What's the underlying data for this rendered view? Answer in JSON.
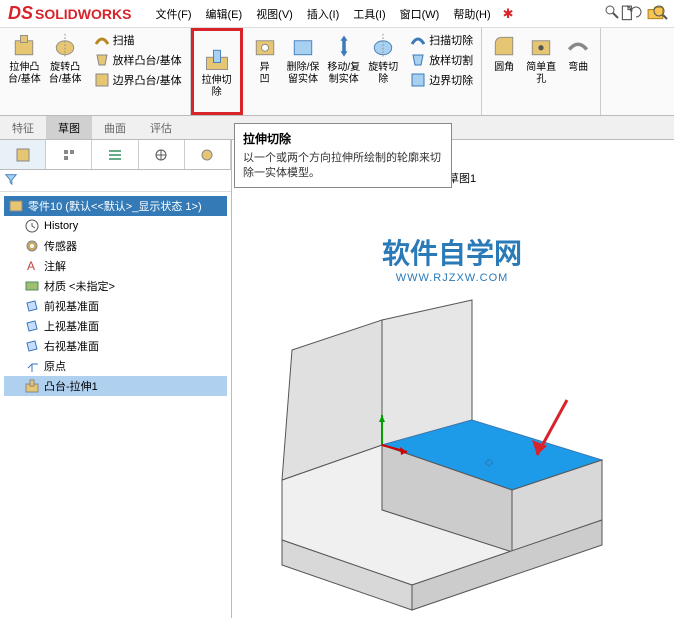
{
  "app": {
    "name": "SOLIDWORKS",
    "logo_prefix": "DS"
  },
  "menu": {
    "file": "文件(F)",
    "edit": "编辑(E)",
    "view": "视图(V)",
    "insert": "插入(I)",
    "tools": "工具(I)",
    "window": "窗口(W)",
    "help": "帮助(H)"
  },
  "ribbon": {
    "extrude_boss": "拉伸凸\n台/基体",
    "revolve_boss": "旋转凸\n台/基体",
    "sweep": "扫描",
    "loft": "放样凸台/基体",
    "boundary": "边界凸台/基体",
    "extrude_cut": "拉伸切\n除",
    "wizard": "异\n凹",
    "delete_keep": "删除/保\n留实体",
    "move_copy": "移动/复\n制实体",
    "revolve_cut": "旋转切\n除",
    "sweep_cut": "扫描切除",
    "loft_cut": "放样切割",
    "boundary_cut": "边界切除",
    "fillet": "圆角",
    "simple_hole": "简单直\n孔",
    "bend": "弯曲"
  },
  "tabs": {
    "feature": "特征",
    "sketch": "草图",
    "surface": "曲面",
    "evaluate": "评估"
  },
  "tree": {
    "root": "零件10 (默认<<默认>_显示状态 1>)",
    "history": "History",
    "sensors": "传感器",
    "annotations": "注解",
    "material": "材质 <未指定>",
    "front_plane": "前视基准面",
    "top_plane": "上视基准面",
    "right_plane": "右视基准面",
    "origin": "原点",
    "boss_extrude": "凸台-拉伸1"
  },
  "tooltip": {
    "title": "拉伸切除",
    "text": "以一个或两个方向拉伸所绘制的轮廓来切除一实体模型。"
  },
  "breadcrumb": {
    "sketch": "草图1"
  },
  "watermark": {
    "main": "软件自学网",
    "sub": "WWW.RJZXW.COM"
  }
}
